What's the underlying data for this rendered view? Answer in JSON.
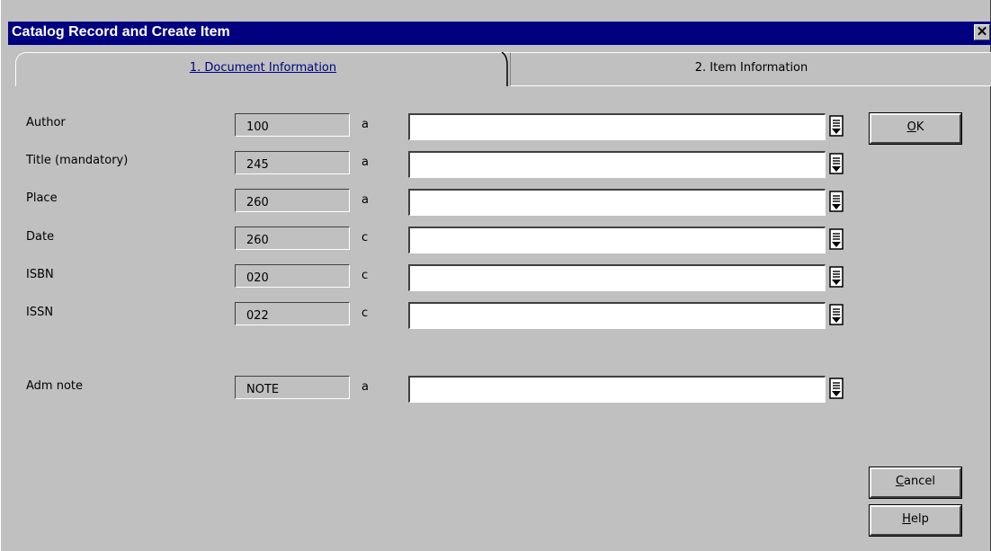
{
  "window": {
    "title": "Catalog Record and Create Item",
    "close_glyph": "✕"
  },
  "tabs": [
    {
      "label": "1. Document Information",
      "active": true
    },
    {
      "label": "2. Item Information",
      "active": false
    }
  ],
  "fields": [
    {
      "label": "Author",
      "tag": "100",
      "subfield": "a",
      "value": ""
    },
    {
      "label": "Title (mandatory)",
      "tag": "245",
      "subfield": "a",
      "value": ""
    },
    {
      "label": "Place",
      "tag": "260",
      "subfield": "a",
      "value": ""
    },
    {
      "label": "Date",
      "tag": "260",
      "subfield": "c",
      "value": ""
    },
    {
      "label": "ISBN",
      "tag": "020",
      "subfield": "c",
      "value": ""
    },
    {
      "label": "ISSN",
      "tag": "022",
      "subfield": "c",
      "value": ""
    },
    {
      "label": "Adm note",
      "tag": "NOTE",
      "subfield": "a",
      "value": ""
    }
  ],
  "buttons": {
    "ok": {
      "mnemonic": "O",
      "rest": "K"
    },
    "cancel": {
      "mnemonic": "C",
      "rest": "ancel"
    },
    "help": {
      "mnemonic": "H",
      "rest": "elp"
    }
  },
  "icons": {
    "list": "dropdown-list-icon"
  },
  "colors": {
    "titlebar": "#000080",
    "face": "#c0c0c0",
    "active_tab_text": "#000080"
  }
}
